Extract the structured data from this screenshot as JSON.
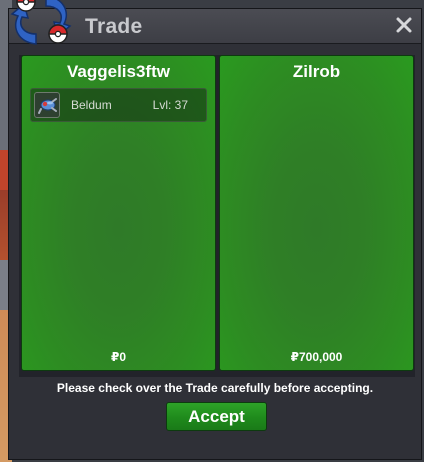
{
  "window": {
    "title": "Trade",
    "close_icon": "close-icon"
  },
  "panels": [
    {
      "player": "Vaggelis3ftw",
      "items": [
        {
          "name": "Beldum",
          "level": "Lvl: 37",
          "icon": "beldum-icon"
        }
      ],
      "money": "₽0"
    },
    {
      "player": "Zilrob",
      "items": [],
      "money": "₽700,000"
    }
  ],
  "notice": "Please check over the Trade carefully before accepting.",
  "buttons": {
    "accept": "Accept"
  },
  "colors": {
    "panel_green": "#2d8c22",
    "button_green": "#1f8a1c",
    "window_bg": "#2f3037"
  }
}
